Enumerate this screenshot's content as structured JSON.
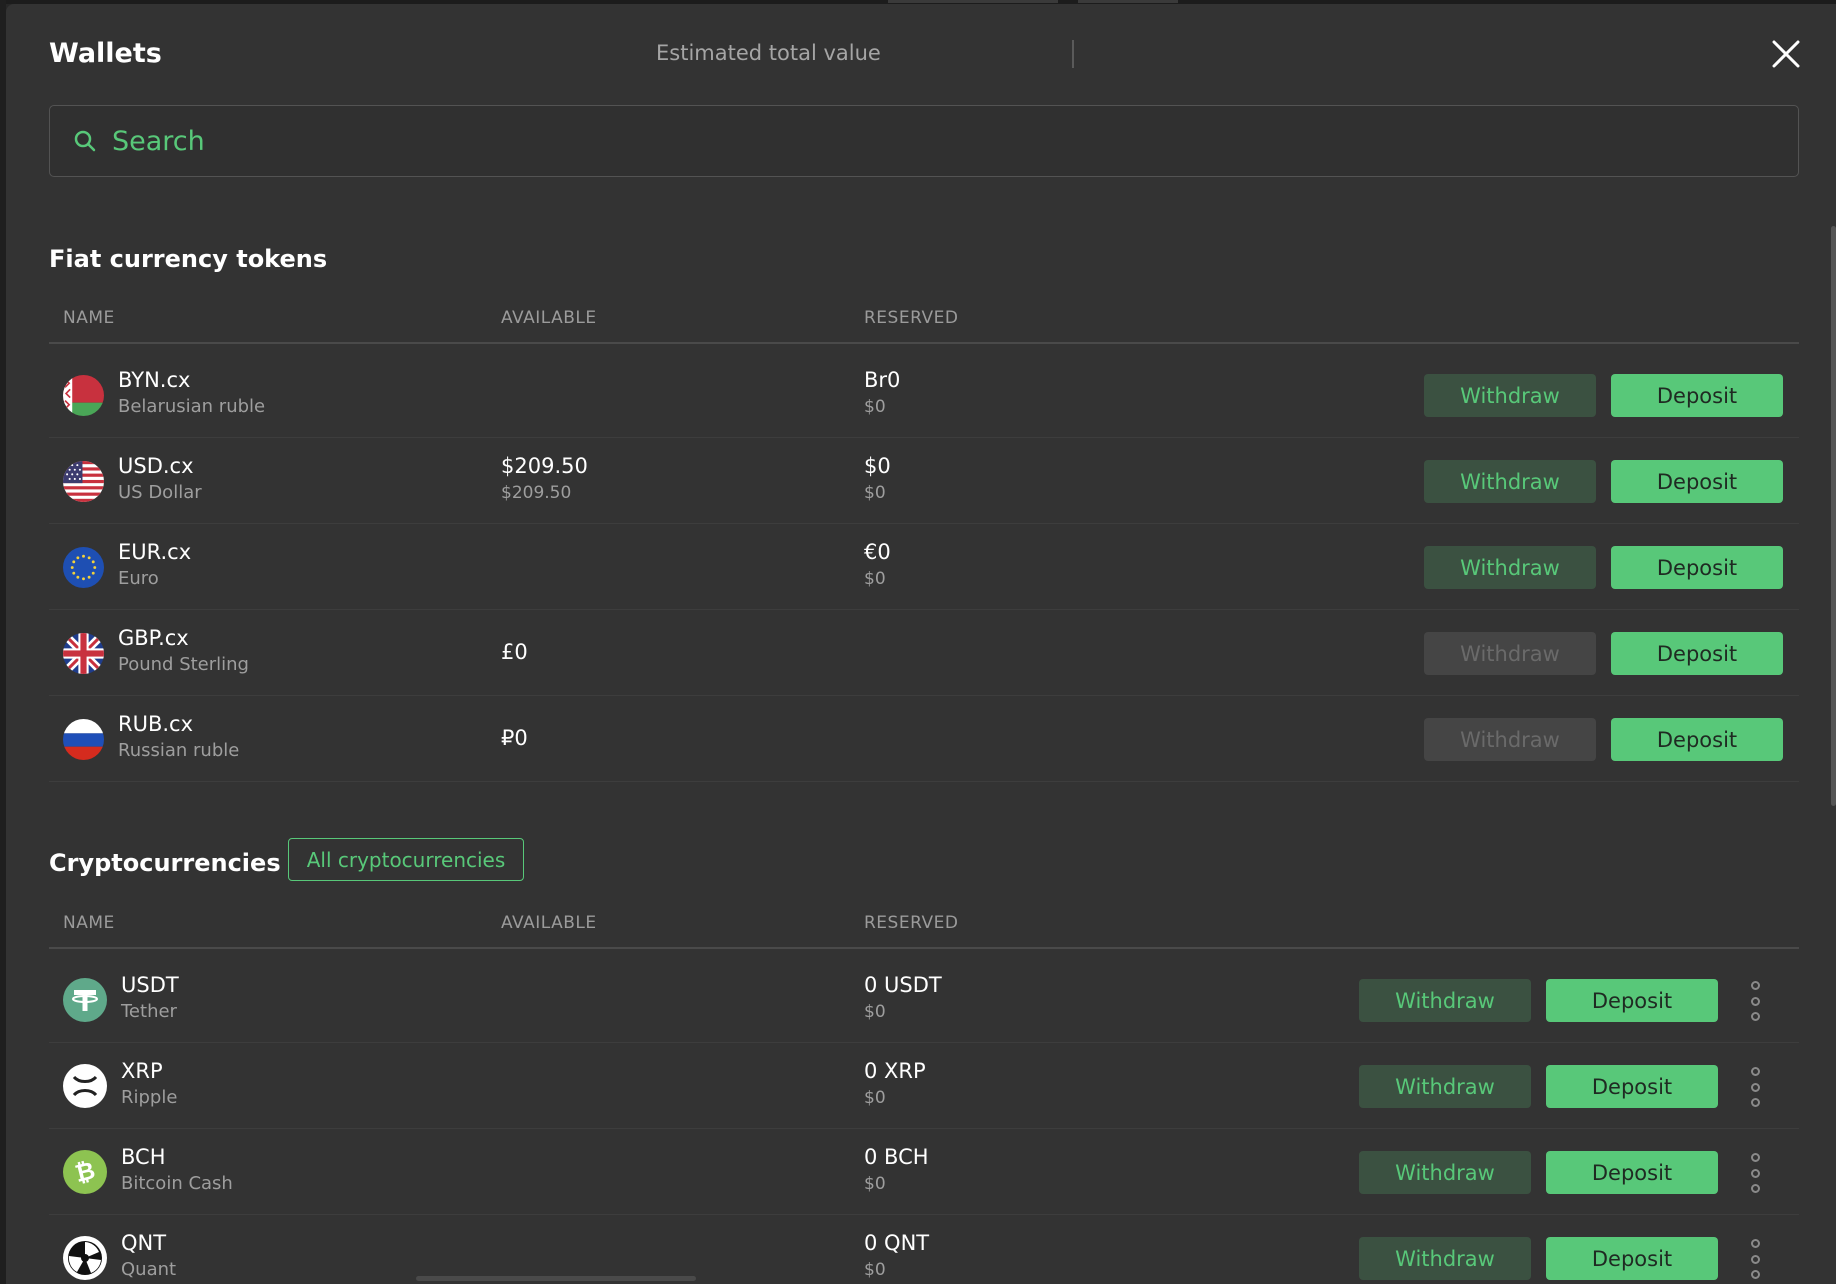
{
  "header": {
    "title": "Wallets",
    "estimated_label": "Estimated total value"
  },
  "search": {
    "placeholder": "Search"
  },
  "columns": {
    "name": "NAME",
    "available": "AVAILABLE",
    "reserved": "RESERVED"
  },
  "actions": {
    "withdraw": "Withdraw",
    "deposit": "Deposit"
  },
  "fiat": {
    "title": "Fiat currency tokens",
    "rows": [
      {
        "symbol": "BYN.cx",
        "name": "Belarusian ruble",
        "available": "",
        "available_usd": "",
        "reserved": "Br0",
        "reserved_usd": "$0",
        "withdraw_enabled": true,
        "icon": "belarus-flag-icon"
      },
      {
        "symbol": "USD.cx",
        "name": "US Dollar",
        "available": "$209.50",
        "available_usd": "$209.50",
        "reserved": "$0",
        "reserved_usd": "$0",
        "withdraw_enabled": true,
        "icon": "us-flag-icon"
      },
      {
        "symbol": "EUR.cx",
        "name": "Euro",
        "available": "",
        "available_usd": "",
        "reserved": "€0",
        "reserved_usd": "$0",
        "withdraw_enabled": true,
        "icon": "eu-flag-icon"
      },
      {
        "symbol": "GBP.cx",
        "name": "Pound Sterling",
        "available": "£0",
        "available_usd": "",
        "reserved": "",
        "reserved_usd": "",
        "withdraw_enabled": false,
        "icon": "uk-flag-icon"
      },
      {
        "symbol": "RUB.cx",
        "name": "Russian ruble",
        "available": "₽0",
        "available_usd": "",
        "reserved": "",
        "reserved_usd": "",
        "withdraw_enabled": false,
        "icon": "russia-flag-icon"
      }
    ]
  },
  "crypto": {
    "title": "Cryptocurrencies",
    "filter_label": "All cryptocurrencies",
    "rows": [
      {
        "symbol": "USDT",
        "name": "Tether",
        "reserved": "0 USDT",
        "reserved_usd": "$0",
        "icon": "tether-icon"
      },
      {
        "symbol": "XRP",
        "name": "Ripple",
        "reserved": "0 XRP",
        "reserved_usd": "$0",
        "icon": "xrp-icon"
      },
      {
        "symbol": "BCH",
        "name": "Bitcoin Cash",
        "reserved": "0 BCH",
        "reserved_usd": "$0",
        "icon": "bitcoin-cash-icon"
      },
      {
        "symbol": "QNT",
        "name": "Quant",
        "reserved": "0 QNT",
        "reserved_usd": "$0",
        "icon": "quant-icon"
      }
    ]
  },
  "colors": {
    "accent": "#58c879",
    "modal_bg": "#333333",
    "withdraw_bg": "#3b5141",
    "disabled_bg": "#454545"
  }
}
